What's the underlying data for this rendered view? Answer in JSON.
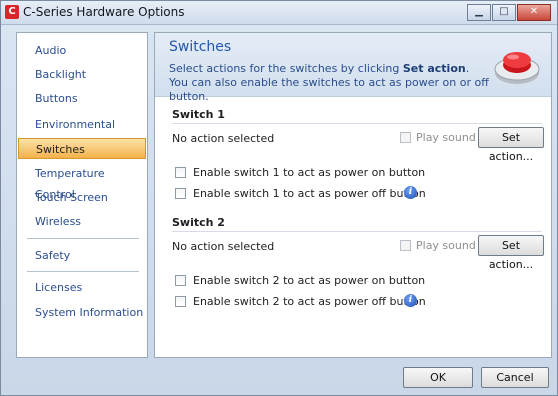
{
  "window": {
    "title": "C-Series Hardware Options",
    "app_icon": "C"
  },
  "sidebar": {
    "items": [
      {
        "label": "Audio"
      },
      {
        "label": "Backlight"
      },
      {
        "label": "Buttons"
      },
      {
        "label": "Environmental Control"
      },
      {
        "label": "Switches"
      },
      {
        "label": "Temperature Control"
      },
      {
        "label": "Touch Screen"
      },
      {
        "label": "Wireless"
      },
      {
        "label": "Safety"
      },
      {
        "label": "Licenses"
      },
      {
        "label": "System Information"
      }
    ],
    "active": "Switches"
  },
  "header": {
    "title": "Switches",
    "desc_before": "Select actions for the switches by clicking ",
    "desc_bold": "Set action",
    "desc_after": ". You can also enable the switches to act as power on or off button."
  },
  "switch1": {
    "title": "Switch 1",
    "status": "No action selected",
    "play_sound": "Play sound",
    "set_action": "Set action...",
    "power_on": "Enable switch 1 to act as power on button",
    "power_off": "Enable switch 1 to act as power off button"
  },
  "switch2": {
    "title": "Switch 2",
    "status": "No action selected",
    "play_sound": "Play sound",
    "set_action": "Set action...",
    "power_on": "Enable switch 2 to act as power on button",
    "power_off": "Enable switch 2 to act as power off button"
  },
  "footer": {
    "ok": "OK",
    "cancel": "Cancel"
  },
  "icons": {
    "info": "i"
  },
  "colors": {
    "accent": "#2357a8",
    "active_nav": "#f3b14a",
    "brand": "#d8262b"
  }
}
